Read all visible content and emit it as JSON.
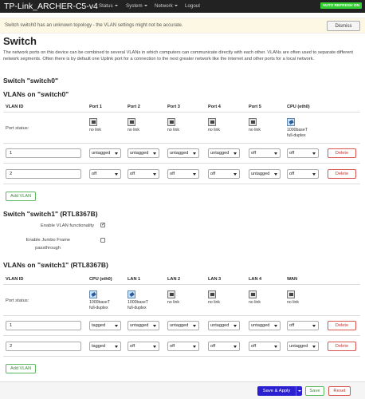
{
  "brand": "TP-Link_ARCHER-C5-v4",
  "menu": {
    "status": "Status",
    "system": "System",
    "network": "Network",
    "logout": "Logout"
  },
  "autorefresh": "AUTO REFRESH ON",
  "alert": {
    "text": "Switch switch0 has an unknown topology - the VLAN settings might not be accurate.",
    "dismiss": "Dismiss"
  },
  "page_title": "Switch",
  "intro": "The network ports on this device can be combined to several VLANs in which computers can communicate directly with each other. VLANs are often used to separate different network segments. Often there is by default one Uplink port for a connection to the next greater network like the internet and other ports for a local network.",
  "switch0": {
    "heading": "Switch \"switch0\"",
    "vlans_heading": "VLANs on \"switch0\"",
    "columns": [
      "VLAN ID",
      "Port 1",
      "Port 2",
      "Port 3",
      "Port 4",
      "Port 5",
      "CPU (eth0)"
    ],
    "port_status_label": "Port status:",
    "port_status": [
      {
        "line1": "no link",
        "line2": "",
        "up": false
      },
      {
        "line1": "no link",
        "line2": "",
        "up": false
      },
      {
        "line1": "no link",
        "line2": "",
        "up": false
      },
      {
        "line1": "no link",
        "line2": "",
        "up": false
      },
      {
        "line1": "no link",
        "line2": "",
        "up": false
      },
      {
        "line1": "1000baseT",
        "line2": "full-duplex",
        "up": true
      }
    ],
    "rows": [
      {
        "vid": "1",
        "ports": [
          "untagged",
          "untagged",
          "untagged",
          "untagged",
          "off",
          "off"
        ]
      },
      {
        "vid": "2",
        "ports": [
          "off",
          "off",
          "off",
          "off",
          "untagged",
          "off"
        ]
      }
    ],
    "delete_label": "Delete",
    "add_label": "Add VLAN"
  },
  "switch1": {
    "heading": "Switch \"switch1\" (RTL8367B)",
    "enable_vlan_label": "Enable VLAN functionality",
    "enable_vlan": true,
    "jumbo_label_1": "Enable Jumbo Frame",
    "jumbo_label_2": "passthrough",
    "jumbo": false,
    "vlans_heading": "VLANs on \"switch1\" (RTL8367B)",
    "columns": [
      "VLAN ID",
      "CPU (eth0)",
      "LAN 1",
      "LAN 2",
      "LAN 3",
      "LAN 4",
      "WAN"
    ],
    "port_status_label": "Port status:",
    "port_status": [
      {
        "line1": "1000baseT",
        "line2": "full-duplex",
        "up": true
      },
      {
        "line1": "1000baseT",
        "line2": "full-duplex",
        "up": true
      },
      {
        "line1": "no link",
        "line2": "",
        "up": false
      },
      {
        "line1": "no link",
        "line2": "",
        "up": false
      },
      {
        "line1": "no link",
        "line2": "",
        "up": false
      },
      {
        "line1": "no link",
        "line2": "",
        "up": false
      }
    ],
    "rows": [
      {
        "vid": "1",
        "ports": [
          "tagged",
          "untagged",
          "untagged",
          "untagged",
          "untagged",
          "off"
        ]
      },
      {
        "vid": "2",
        "ports": [
          "tagged",
          "off",
          "off",
          "off",
          "off",
          "untagged"
        ]
      }
    ],
    "delete_label": "Delete",
    "add_label": "Add VLAN"
  },
  "footer": {
    "save_apply": "Save & Apply",
    "save": "Save",
    "reset": "Reset"
  }
}
